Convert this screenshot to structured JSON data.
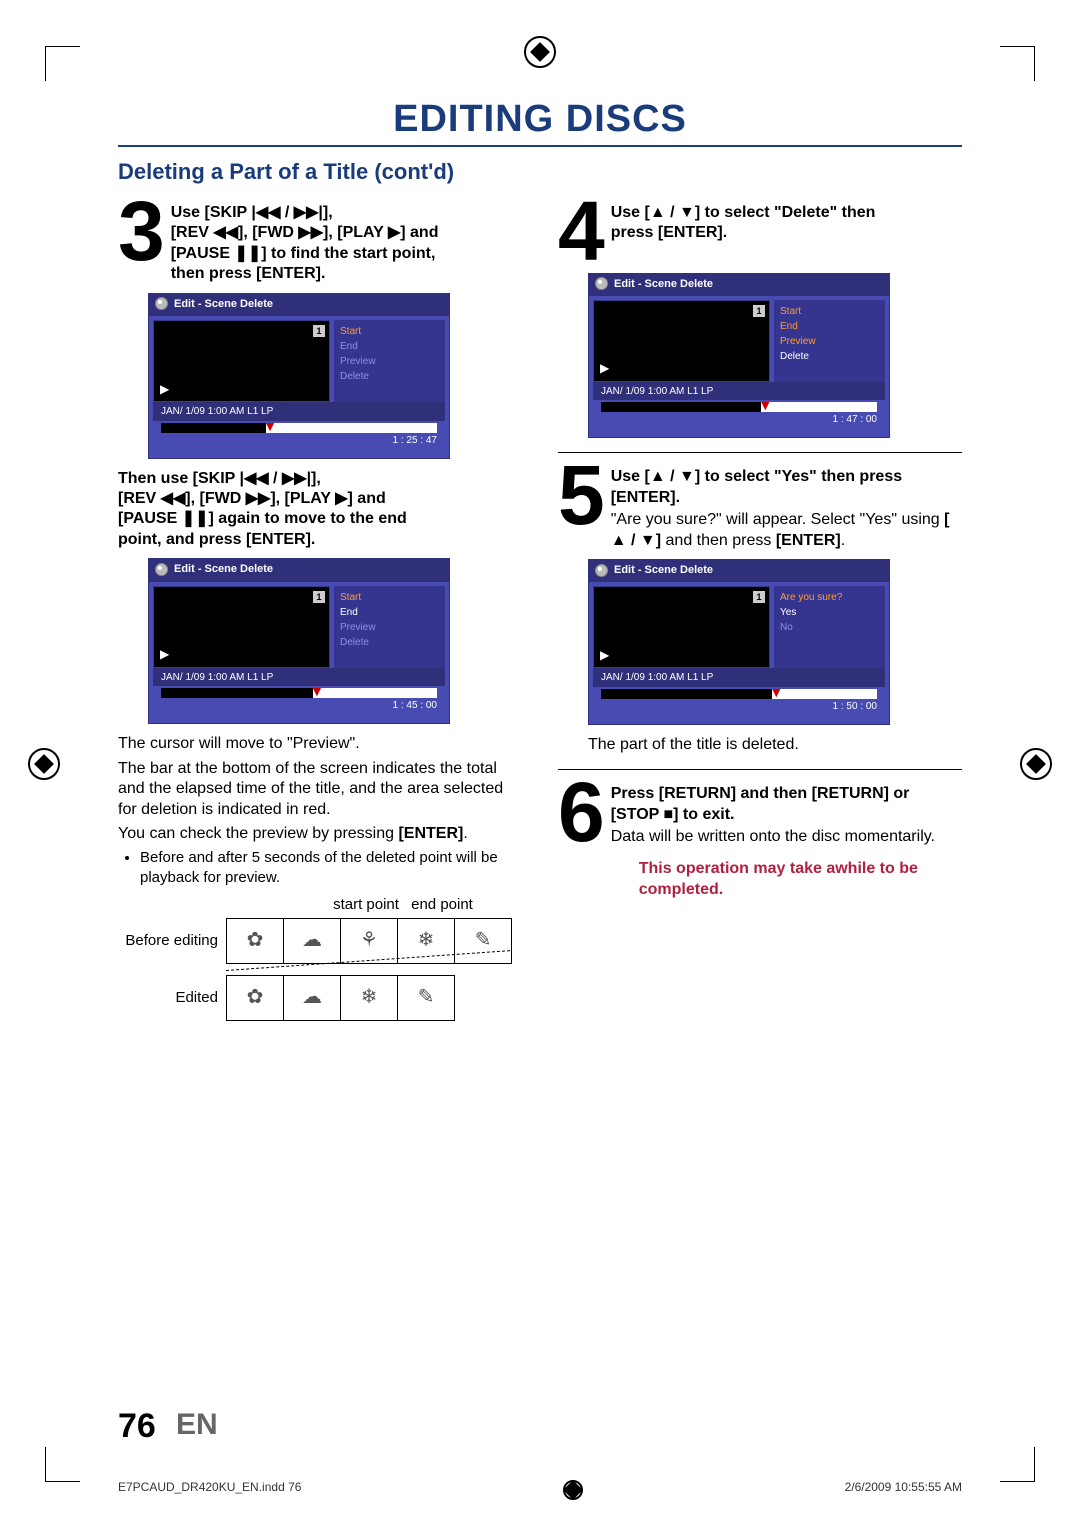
{
  "page": {
    "title": "EDITING DISCS",
    "subhead": "Deleting a Part of a Title (cont'd)",
    "number": "76",
    "lang": "EN"
  },
  "footer": {
    "left": "E7PCAUD_DR420KU_EN.indd   76",
    "right": "2/6/2009   10:55:55 AM"
  },
  "panel_labels": {
    "title": "Edit - Scene Delete",
    "status": "JAN/ 1/09 1:00 AM L1   LP",
    "start": "Start",
    "end": "End",
    "preview": "Preview",
    "delete": "Delete",
    "are_you_sure": "Are you sure?",
    "yes": "Yes",
    "no": "No"
  },
  "times": {
    "p3a": "1 : 25 : 47",
    "p3b": "1 : 45 : 00",
    "p4": "1 : 47 : 00",
    "p5": "1 : 50 : 00"
  },
  "step3": {
    "h1a": "Use [SKIP ",
    "h1b": "], ",
    "h2a": "[REV ",
    "h2b": "], [FWD ",
    "h2c": "], [PLAY ",
    "h2d": "] and ",
    "h3a": "[PAUSE ",
    "h3b": "] to find the start point, ",
    "h4": "then press [ENTER].",
    "m1a": "Then use [SKIP ",
    "m1b": "], ",
    "m2a": "[REV ",
    "m2b": "], [FWD ",
    "m2c": "], [PLAY ",
    "m2d": "] and ",
    "m3a": "[PAUSE ",
    "m3b": "] again to move to the end ",
    "m4": "point, and press [ENTER].",
    "body1": "The cursor will move to \"Preview\".",
    "body2": "The bar at the bottom of the screen indicates the total and the elapsed time of the title, and the area selected for deletion is indicated in red.",
    "body3a": "You can check the preview by pressing ",
    "body3b": "[ENTER]",
    "body3c": ".",
    "bullet1": "Before and after 5 seconds of the deleted point will be playback for preview."
  },
  "film": {
    "startpoint": "start point",
    "endpoint": "end point",
    "before": "Before editing",
    "edited": "Edited"
  },
  "step4": {
    "l1a": "Use [",
    "l1b": " / ",
    "l1c": "] to select \"Delete\" then ",
    "l2": "press [ENTER]."
  },
  "step5": {
    "l1a": "Use [",
    "l1b": " / ",
    "l1c": "] to select \"Yes\" then press ",
    "l2": "[ENTER].",
    "b1a": "\"Are you sure?\" will appear. Select \"Yes\" using ",
    "b1b": "[",
    "b1c": " / ",
    "b1d": "]",
    "b1e": " and then press ",
    "b1f": "[ENTER]",
    "b1g": ".",
    "b2": "The part of the title is deleted."
  },
  "step6": {
    "l1a": "Press [RETURN] and then [RETURN] or ",
    "l2a": "[STOP ",
    "l2b": "] to exit.",
    "b1": "Data will be written onto the disc momentarily.",
    "warn": "This operation may take awhile to be completed."
  }
}
